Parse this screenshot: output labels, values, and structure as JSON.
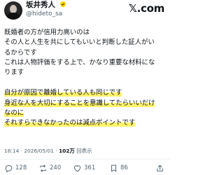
{
  "header": {
    "name": "坂井秀人",
    "verified_icon": "verified-badge-icon",
    "handle": "@hideto_sa",
    "brand": "𝕏.com"
  },
  "post": {
    "lines_a": [
      "既婚者の方が信用力高いのは",
      "その人と人生を共にしてもいいと判断した証人がい",
      "るからです",
      "これは人物評価をする上で、かなり重要な材料にな",
      "ります"
    ],
    "lines_b": [
      "自分が原因で離婚している人も同じです",
      "身近な人を大切にすることを意識してたらいいだけ",
      "なのに",
      "それすらできなかったのは減点ポイントです"
    ]
  },
  "meta": {
    "time_date": "18:14 · 2026/05/01 · ",
    "views_count": "102万",
    "views_label": "回表示"
  },
  "actions": {
    "replies": "128",
    "reposts": "240",
    "likes": "361",
    "bookmarks": "86"
  },
  "colors": {
    "highlight": "#fff36b",
    "verified": "#ffd400",
    "muted": "#536471"
  }
}
